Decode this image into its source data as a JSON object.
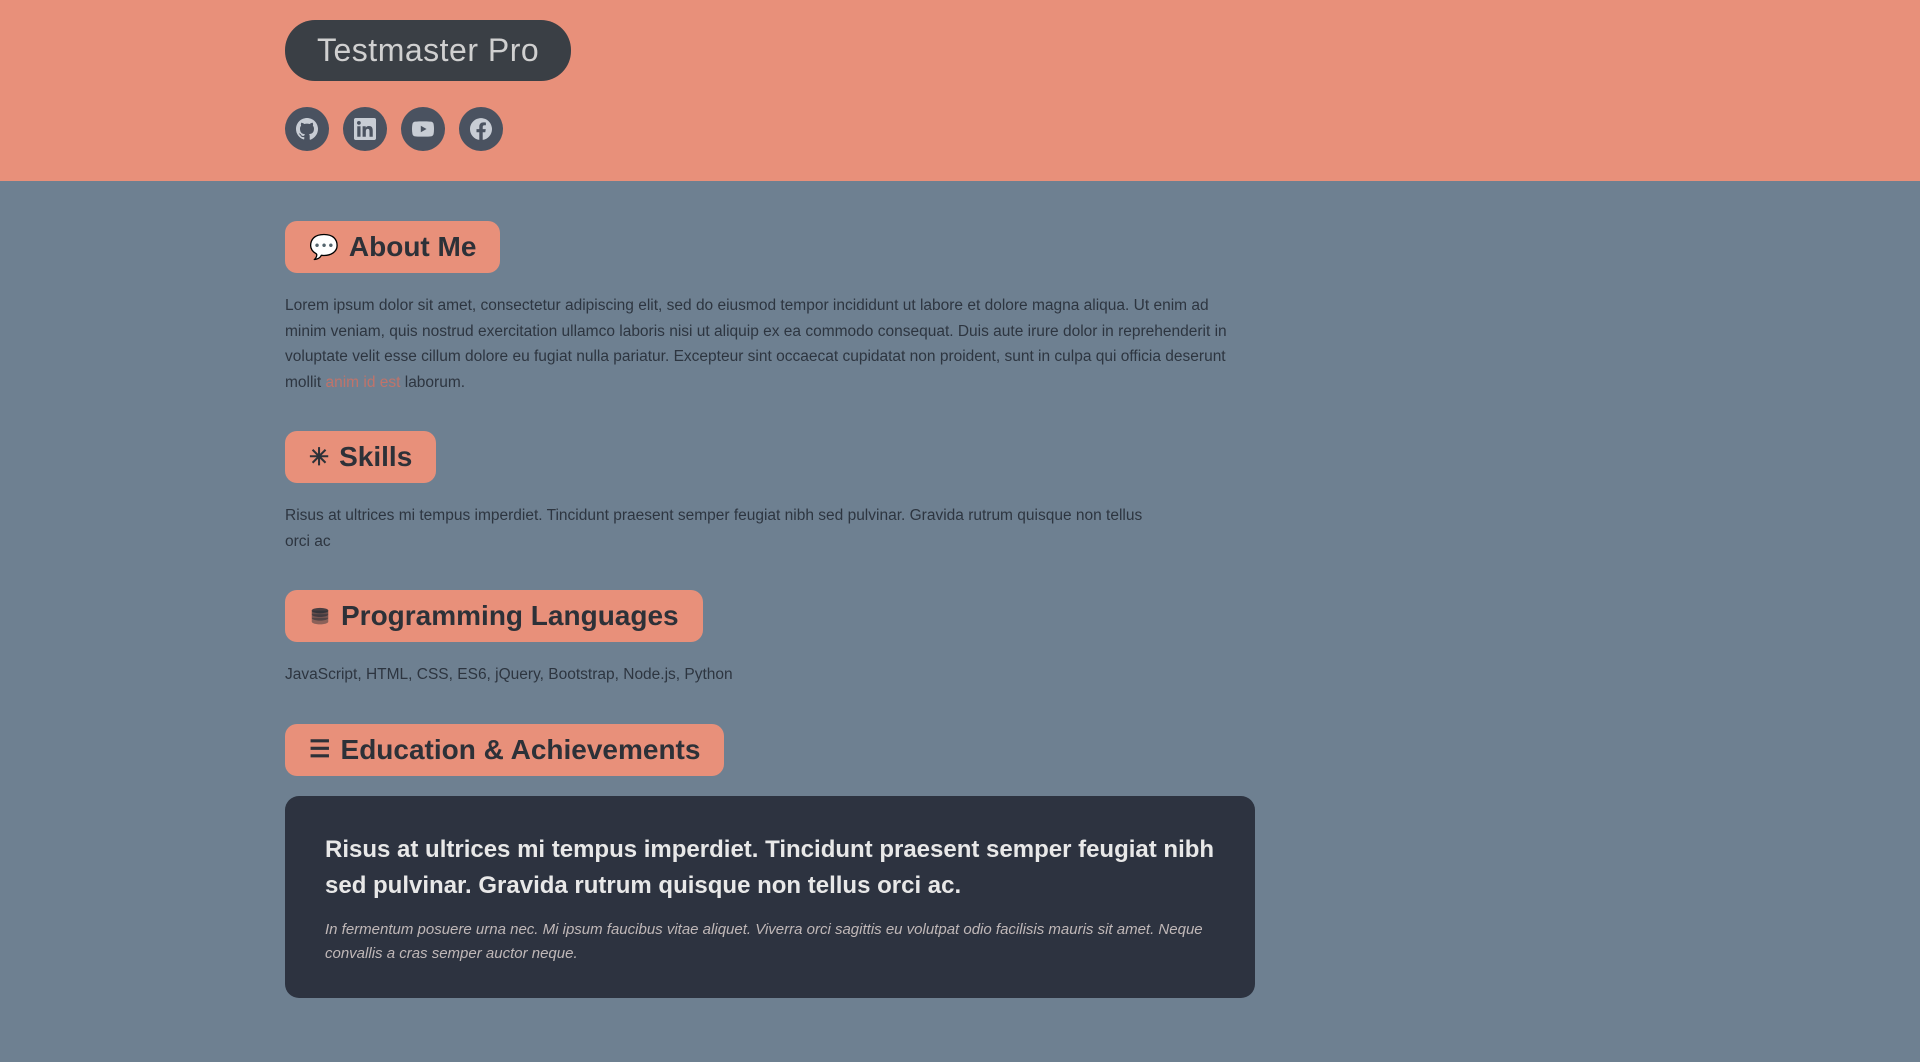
{
  "header": {
    "brand": "Testmaster Pro",
    "social_icons": [
      {
        "name": "github-icon",
        "symbol": "⊙",
        "label": "GitHub"
      },
      {
        "name": "linkedin-icon",
        "symbol": "in",
        "label": "LinkedIn"
      },
      {
        "name": "youtube-icon",
        "symbol": "▶",
        "label": "YouTube"
      },
      {
        "name": "facebook-icon",
        "symbol": "f",
        "label": "Facebook"
      }
    ]
  },
  "sections": {
    "about": {
      "heading": "About Me",
      "icon": "💬",
      "text_normal": "Lorem ipsum dolor sit amet, consectetur adipiscing elit, sed do eiusmod tempor incididunt ut labore et dolore magna aliqua. Ut enim ad minim veniam, quis nostrud exercitation ullamco laboris nisi ut aliquip ex ea commodo consequat. Duis aute irure dolor in reprehenderit in voluptate velit esse cillum dolore eu fugiat nulla pariatur. Excepteur sint occaecat cupidatat non proident, sunt in culpa qui officia deserunt mollit ",
      "text_highlight": "anim id est",
      "text_end": " laborum."
    },
    "skills": {
      "heading": "Skills",
      "icon": "✳",
      "text": "Risus at ultrices mi tempus imperdiet. Tincidunt praesent semper feugiat nibh sed pulvinar. Gravida rutrum quisque non tellus orci ac"
    },
    "programming": {
      "heading": "Programming Languages",
      "icon": "🗄",
      "text": "JavaScript, HTML, CSS, ES6, jQuery, Bootstrap, Node.js, Python"
    },
    "education": {
      "heading": "Education & Achievements",
      "icon": "☰",
      "card": {
        "title": "Risus at ultrices mi tempus imperdiet. Tincidunt praesent semper feugiat nibh sed pulvinar. Gravida rutrum quisque non tellus orci ac.",
        "subtitle": "In fermentum posuere urna nec. Mi ipsum faucibus vitae aliquet. Viverra orci sagittis eu volutpat odio facilisis mauris sit amet. Neque convallis a cras semper auctor neque."
      }
    }
  }
}
